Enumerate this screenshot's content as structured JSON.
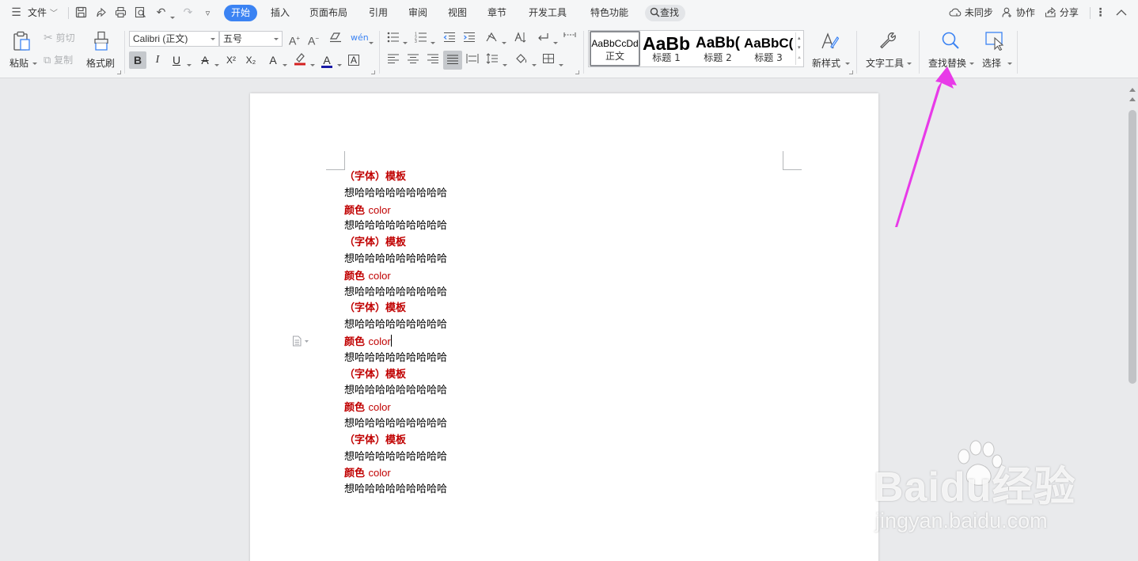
{
  "menubar": {
    "file_label": "文件",
    "tabs": [
      "开始",
      "插入",
      "页面布局",
      "引用",
      "审阅",
      "视图",
      "章节",
      "开发工具",
      "特色功能"
    ],
    "search_label": "查找",
    "right": {
      "sync": "未同步",
      "collab": "协作",
      "share": "分享"
    }
  },
  "ribbon": {
    "clipboard": {
      "paste": "粘贴",
      "cut": "剪切",
      "copy": "复制",
      "format_painter": "格式刷"
    },
    "font": {
      "name": "Calibri (正文)",
      "size": "五号"
    },
    "format_buttons": {
      "bold": "B",
      "italic": "I",
      "underline": "U",
      "superscript": "X²",
      "subscript": "X₂"
    },
    "styles": [
      {
        "preview": "AaBbCcDd",
        "label": "正文"
      },
      {
        "preview": "AaBb",
        "label": "标题 1"
      },
      {
        "preview": "AaBb(",
        "label": "标题 2"
      },
      {
        "preview": "AaBbC(",
        "label": "标题 3"
      }
    ],
    "new_style": "新样式",
    "text_tools": "文字工具",
    "find_replace": "查找替换",
    "select": "选择"
  },
  "document": {
    "lines": [
      {
        "type": "heading",
        "text": "（字体）模板"
      },
      {
        "type": "body",
        "text": "想哈哈哈哈哈哈哈哈哈"
      },
      {
        "type": "color",
        "cn": "颜色",
        "en": "color"
      },
      {
        "type": "body",
        "text": "想哈哈哈哈哈哈哈哈哈"
      },
      {
        "type": "heading",
        "text": "（字体）模板"
      },
      {
        "type": "body",
        "text": "想哈哈哈哈哈哈哈哈哈"
      },
      {
        "type": "color",
        "cn": "颜色",
        "en": "color"
      },
      {
        "type": "body",
        "text": "想哈哈哈哈哈哈哈哈哈"
      },
      {
        "type": "heading",
        "text": "（字体）模板"
      },
      {
        "type": "body",
        "text": "想哈哈哈哈哈哈哈哈哈"
      },
      {
        "type": "color",
        "cn": "颜色",
        "en": "color"
      },
      {
        "type": "body",
        "text": "想哈哈哈哈哈哈哈哈哈"
      },
      {
        "type": "heading",
        "text": "（字体）模板"
      },
      {
        "type": "body",
        "text": "想哈哈哈哈哈哈哈哈哈"
      },
      {
        "type": "color",
        "cn": "颜色",
        "en": "color"
      },
      {
        "type": "body",
        "text": "想哈哈哈哈哈哈哈哈哈"
      },
      {
        "type": "heading",
        "text": "（字体）模板"
      },
      {
        "type": "body",
        "text": "想哈哈哈哈哈哈哈哈哈"
      },
      {
        "type": "color",
        "cn": "颜色",
        "en": "color"
      },
      {
        "type": "body",
        "text": "想哈哈哈哈哈哈哈哈哈"
      }
    ]
  },
  "watermark": {
    "line1": "Baidu经验",
    "line2": "jingyan.baidu.com"
  },
  "colors": {
    "accent": "#3b83f3",
    "doc_red": "#c00000",
    "arrow": "#e83ae8",
    "font_color": "#c00000",
    "highlight": "#d42020"
  }
}
